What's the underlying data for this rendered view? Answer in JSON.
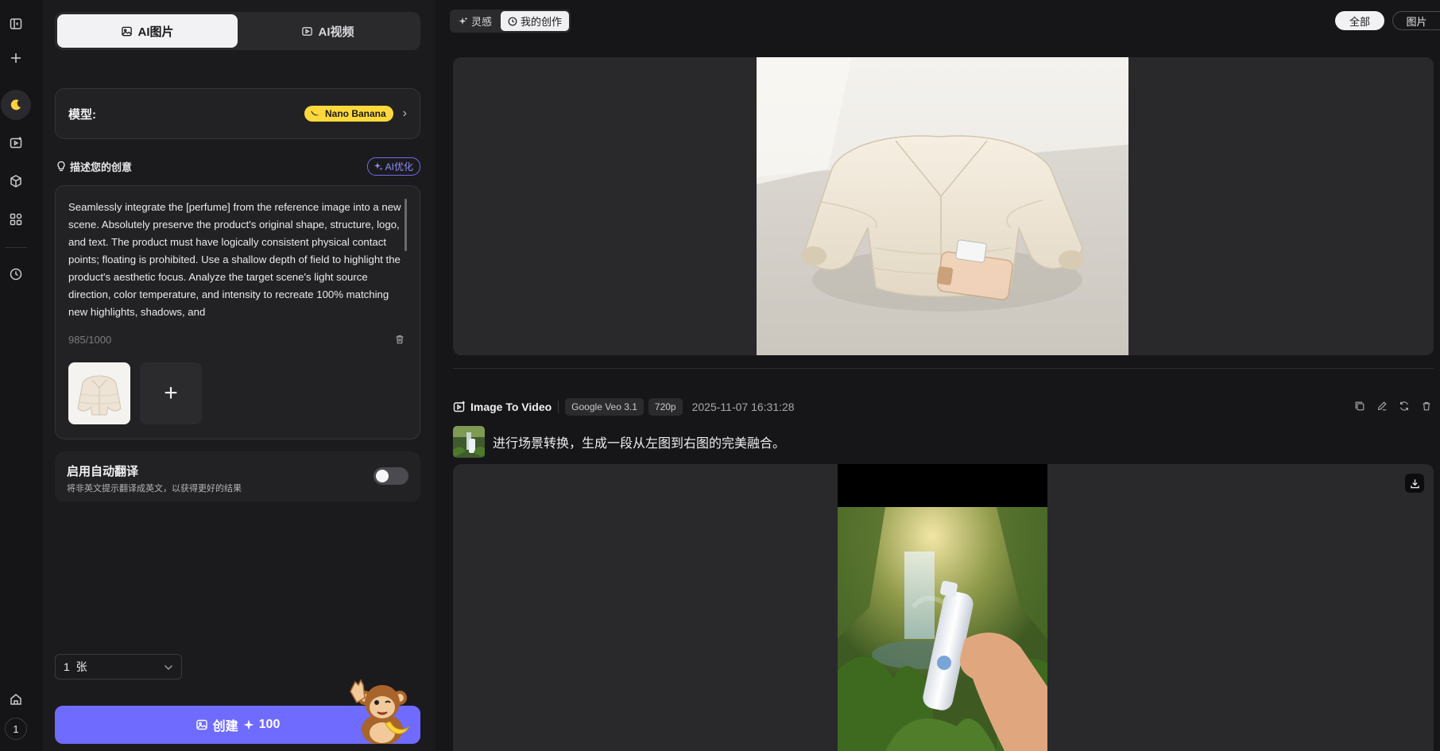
{
  "rail": {
    "items": [
      "panel-toggle",
      "new",
      "moon",
      "video-add",
      "cube",
      "apps",
      "history"
    ],
    "bottom_number": "1"
  },
  "panel": {
    "tabs": [
      {
        "label": "AI图片",
        "active": true
      },
      {
        "label": "AI视频",
        "active": false
      }
    ],
    "model": {
      "label": "模型:",
      "value": "Nano Banana",
      "badge_color": "#ffd93b"
    },
    "describe": {
      "title": "描述您的创意",
      "optimize_label": "AI优化"
    },
    "prompt": {
      "text": "Seamlessly integrate the [perfume] from the reference image into a new scene. Absolutely preserve the product's original shape, structure, logo, and text. The product must have logically consistent physical contact points; floating is prohibited. Use a shallow depth of field to highlight the product's aesthetic focus. Analyze the target scene's light source direction, color temperature, and intensity to recreate 100% matching new highlights, shadows, and",
      "counter": "985/1000",
      "add_symbol": "+"
    },
    "translate": {
      "title": "启用自动翻译",
      "subtitle": "将非英文提示翻译成英文，以获得更好的结果",
      "enabled": false
    },
    "count_select": {
      "value": "1  张"
    },
    "create": {
      "label": "创建",
      "cost": "100",
      "color": "#6f6bff"
    }
  },
  "main": {
    "top_tabs": [
      {
        "label": "灵感",
        "active": false
      },
      {
        "label": "我的创作",
        "active": true
      }
    ],
    "filters": [
      {
        "label": "全部",
        "active": true
      },
      {
        "label": "图片",
        "active": false
      }
    ],
    "item2": {
      "type_label": "Image To Video",
      "model_chip": "Google Veo 3.1",
      "resolution_chip": "720p",
      "date": "2025-11-07 16:31:28",
      "prompt": "进行场景转换，生成一段从左图到右图的完美融合。"
    }
  },
  "colors": {
    "accent": "#6f6bff",
    "panel_bg": "#1b1b1d",
    "card_bg": "#29292c"
  }
}
